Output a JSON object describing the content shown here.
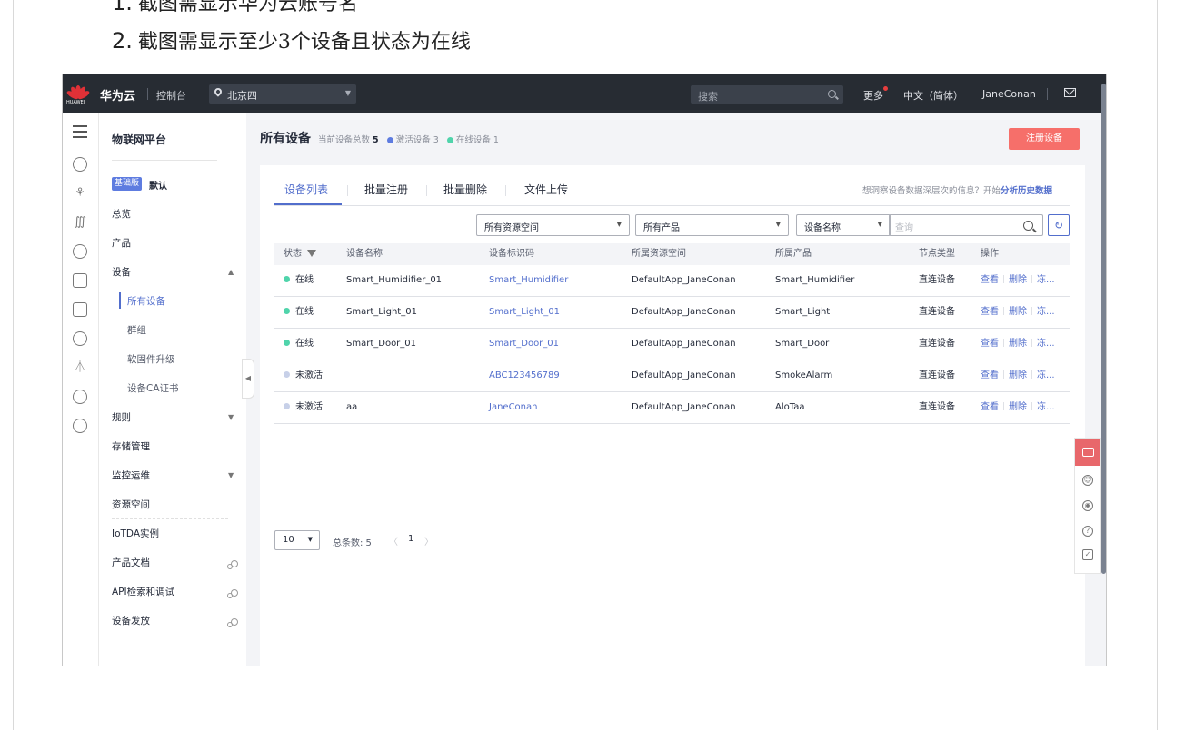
{
  "instructions": [
    {
      "num": "1.",
      "text": "截图需显示华为云账号名"
    },
    {
      "num": "2.",
      "text": "截图需显示至少3个设备且状态为在线"
    }
  ],
  "topbar": {
    "logo_text": "HUAWEI",
    "brand": "华为云",
    "console": "控制台",
    "region": "北京四",
    "search_placeholder": "搜索",
    "more": "更多",
    "language": "中文（简体）",
    "username": "JaneConan"
  },
  "sidenav": {
    "title": "物联网平台",
    "edition_badge": "基础版",
    "edition_default": "默认",
    "items": [
      {
        "label": "总览"
      },
      {
        "label": "产品"
      },
      {
        "label": "设备"
      },
      {
        "label": "所有设备"
      },
      {
        "label": "群组"
      },
      {
        "label": "软固件升级"
      },
      {
        "label": "设备CA证书"
      },
      {
        "label": "规则"
      },
      {
        "label": "存储管理"
      },
      {
        "label": "监控运维"
      },
      {
        "label": "资源空间"
      },
      {
        "label": "IoTDA实例"
      },
      {
        "label": "产品文档"
      },
      {
        "label": "API检索和调试"
      },
      {
        "label": "设备发放"
      }
    ]
  },
  "header": {
    "title": "所有设备",
    "total_label": "当前设备总数",
    "total": "5",
    "activated_label": "激活设备",
    "activated": "3",
    "online_label": "在线设备",
    "online": "1",
    "register_button": "注册设备"
  },
  "tabs": [
    {
      "label": "设备列表"
    },
    {
      "label": "批量注册"
    },
    {
      "label": "批量删除"
    },
    {
      "label": "文件上传"
    }
  ],
  "hint": {
    "text": "想洞察设备数据深层次的信息？开始",
    "link": "分析历史数据"
  },
  "filters": {
    "resource_space": "所有资源空间",
    "product": "所有产品",
    "field": "设备名称",
    "search_placeholder": "查询"
  },
  "table": {
    "columns": [
      "状态",
      "设备名称",
      "设备标识码",
      "所属资源空间",
      "所属产品",
      "节点类型",
      "操作"
    ],
    "rows": [
      {
        "status": "在线",
        "name": "Smart_Humidifier_01",
        "id": "Smart_Humidifier",
        "space": "DefaultApp_JaneConan",
        "product": "Smart_Humidifier",
        "node": "直连设备"
      },
      {
        "status": "在线",
        "name": "Smart_Light_01",
        "id": "Smart_Light_01",
        "space": "DefaultApp_JaneConan",
        "product": "Smart_Light",
        "node": "直连设备"
      },
      {
        "status": "在线",
        "name": "Smart_Door_01",
        "id": "Smart_Door_01",
        "space": "DefaultApp_JaneConan",
        "product": "Smart_Door",
        "node": "直连设备"
      },
      {
        "status": "未激活",
        "name": "",
        "id": "ABC123456789",
        "space": "DefaultApp_JaneConan",
        "product": "SmokeAlarm",
        "node": "直连设备"
      },
      {
        "status": "未激活",
        "name": "aa",
        "id": "JaneConan",
        "space": "DefaultApp_JaneConan",
        "product": "AloTaa",
        "node": "直连设备"
      }
    ],
    "actions": [
      "查看",
      "删除",
      "冻..."
    ]
  },
  "pager": {
    "page_size": "10",
    "total_text": "总条数: 5",
    "current": "1"
  },
  "colors": {
    "online": "#50d4ab",
    "inactive": "#c7d0e8",
    "activated_dot": "#5e7ce0",
    "accent": "#526ecc",
    "register": "#f66f6a"
  }
}
